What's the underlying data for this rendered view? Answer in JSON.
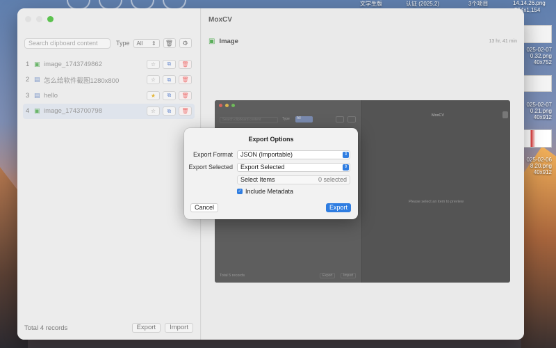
{
  "desktop": {
    "top_labels": [
      "文学生版",
      "认证 (2025.2)",
      "3个项目",
      "14.14.26.png",
      "574x1,154"
    ],
    "files": [
      {
        "name": "025-02-07",
        "detail": "0.32.png",
        "size": "40x752"
      },
      {
        "name": "025-02-07",
        "detail": "0.21.png",
        "size": "40x912"
      },
      {
        "name": "025-02-06",
        "detail": "8.20.png",
        "size": "40x912"
      }
    ]
  },
  "window": {
    "app_title": "MoxCV",
    "search": {
      "placeholder": "Search clipboard content"
    },
    "type_label": "Type",
    "type_value": "All",
    "items": [
      {
        "index": "1",
        "kind": "image",
        "label": "image_1743749862",
        "starred": false
      },
      {
        "index": "2",
        "kind": "text",
        "label": "怎么给软件截图1280x800",
        "starred": false
      },
      {
        "index": "3",
        "kind": "text",
        "label": "hello",
        "starred": true
      },
      {
        "index": "4",
        "kind": "image",
        "label": "image_1743700798",
        "starred": false
      }
    ],
    "total": "Total 4 records",
    "export_label": "Export",
    "import_label": "Import",
    "preview": {
      "kind": "Image",
      "time_ago": "13 hr, 41 min",
      "shot": {
        "search": "Search clipboard content",
        "type_label": "Type",
        "type_value": "All",
        "title": "MoxCV",
        "empty": "Please select an item to preview",
        "total": "Total 5 records",
        "export": "Export",
        "import": "Import"
      }
    }
  },
  "dialog": {
    "title": "Export Options",
    "format_label": "Export Format",
    "format_value": "JSON (Importable)",
    "selected_label": "Export Selected",
    "selected_value": "Export Selected",
    "select_items": "Select Items",
    "selected_count": "0 selected",
    "metadata_label": "Include Metadata",
    "metadata_checked": true,
    "cancel": "Cancel",
    "export": "Export"
  }
}
